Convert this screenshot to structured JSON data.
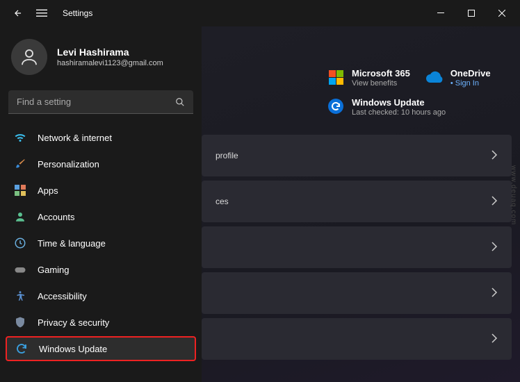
{
  "titlebar": {
    "title": "Settings"
  },
  "user": {
    "name": "Levi Hashirama",
    "email": "hashiramalevi1123@gmail.com"
  },
  "search": {
    "placeholder": "Find a setting"
  },
  "nav": [
    {
      "label": "Network & internet",
      "icon": "wifi"
    },
    {
      "label": "Personalization",
      "icon": "brush"
    },
    {
      "label": "Apps",
      "icon": "apps"
    },
    {
      "label": "Accounts",
      "icon": "person"
    },
    {
      "label": "Time & language",
      "icon": "clock-globe"
    },
    {
      "label": "Gaming",
      "icon": "gamepad"
    },
    {
      "label": "Accessibility",
      "icon": "accessibility"
    },
    {
      "label": "Privacy & security",
      "icon": "shield"
    },
    {
      "label": "Windows Update",
      "icon": "sync"
    }
  ],
  "cards": {
    "ms365": {
      "title": "Microsoft 365",
      "sub": "View benefits"
    },
    "onedrive": {
      "title": "OneDrive",
      "sub": "Sign In"
    },
    "winupdate": {
      "title": "Windows Update",
      "sub": "Last checked: 10 hours ago"
    }
  },
  "panels": [
    {
      "label": "profile"
    },
    {
      "label": "ces"
    },
    {
      "label": ""
    },
    {
      "label": ""
    },
    {
      "label": ""
    }
  ],
  "bullet": "• "
}
